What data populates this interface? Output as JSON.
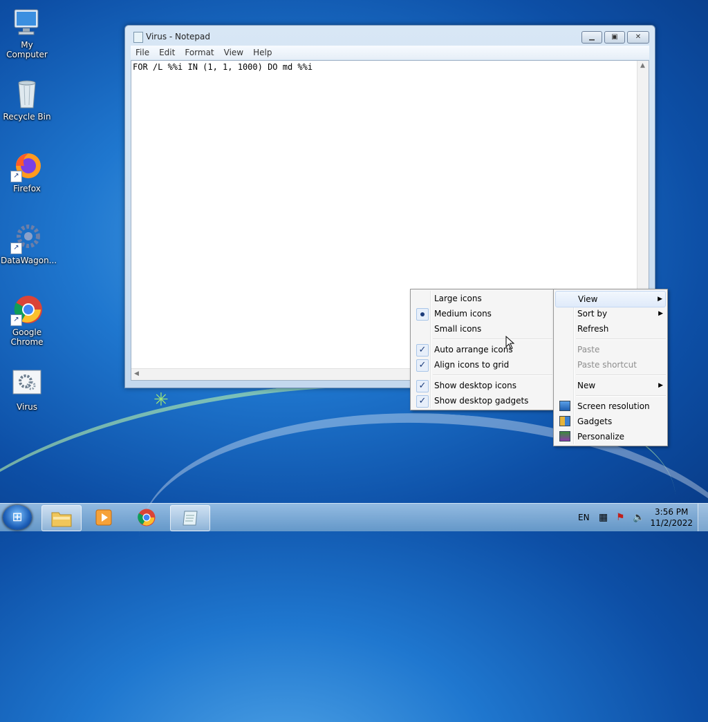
{
  "desktop": {
    "icons": [
      {
        "label": "My Computer",
        "icon": "computer-icon"
      },
      {
        "label": "Recycle Bin",
        "icon": "recycle-bin-icon"
      },
      {
        "label": "Firefox",
        "icon": "firefox-icon"
      },
      {
        "label": "DataWagon...",
        "icon": "datawagon-icon"
      },
      {
        "label": "Google Chrome",
        "icon": "chrome-icon"
      },
      {
        "label": "Virus",
        "icon": "batch-file-icon"
      }
    ]
  },
  "notepad": {
    "title": "Virus - Notepad",
    "menu": [
      "File",
      "Edit",
      "Format",
      "View",
      "Help"
    ],
    "content": "FOR /L %%i IN (1, 1, 1000) DO md %%i"
  },
  "desktop_menu": {
    "items": [
      {
        "label": "View",
        "submenu": true
      },
      {
        "label": "Sort by",
        "submenu": true
      },
      {
        "label": "Refresh"
      },
      {
        "label": "Paste",
        "disabled": true
      },
      {
        "label": "Paste shortcut",
        "disabled": true
      },
      {
        "label": "New",
        "submenu": true
      },
      {
        "label": "Screen resolution"
      },
      {
        "label": "Gadgets"
      },
      {
        "label": "Personalize"
      }
    ]
  },
  "view_submenu": {
    "items": [
      {
        "label": "Large icons"
      },
      {
        "label": "Medium icons",
        "selected": true
      },
      {
        "label": "Small icons"
      },
      {
        "label": "Auto arrange icons",
        "checked": true
      },
      {
        "label": "Align icons to grid",
        "checked": true
      },
      {
        "label": "Show desktop icons",
        "checked": true
      },
      {
        "label": "Show desktop gadgets",
        "checked": true
      }
    ]
  },
  "taskbar": {
    "language": "EN",
    "time": "3:56 PM",
    "date": "11/2/2022"
  }
}
